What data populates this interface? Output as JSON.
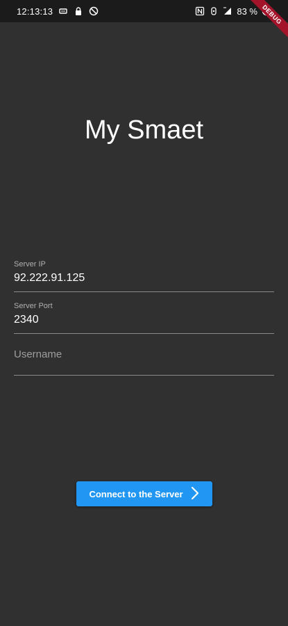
{
  "status_bar": {
    "time": "12:13:13",
    "battery": "83 %",
    "icons": [
      "sim-card-icon",
      "lock-icon",
      "data-saver-icon",
      "nfc-icon",
      "vibrate-icon",
      "signal-icon",
      "battery-icon"
    ]
  },
  "debug_banner": "DEBUG",
  "title": "My Smaet",
  "form": {
    "server_ip": {
      "label": "Server IP",
      "value": "92.222.91.125"
    },
    "server_port": {
      "label": "Server Port",
      "value": "2340"
    },
    "username": {
      "placeholder": "Username",
      "value": ""
    }
  },
  "connect_button": {
    "label": "Connect to the Server",
    "icon": "chevron-right-icon"
  },
  "colors": {
    "background": "#303030",
    "status_bar": "#1b1b1b",
    "accent": "#2196f3",
    "debug_banner": "#a3142a"
  }
}
